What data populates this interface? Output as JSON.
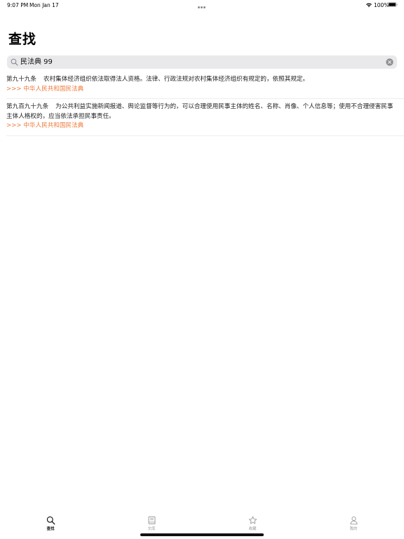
{
  "status_bar": {
    "time": "9:07 PM",
    "date": "Mon Jan 17",
    "battery_text": "100%"
  },
  "page": {
    "title": "查找"
  },
  "search": {
    "value": "民法典 99",
    "placeholder": ""
  },
  "results": [
    {
      "article": "第九十九条",
      "text": "农村集体经济组织依法取得法人资格。法律、行政法规对农村集体经济组织有规定的，依照其规定。",
      "source": ">>> 中华人民共和国民法典"
    },
    {
      "article": "第九百九十九条",
      "text": "为公共利益实施新闻报道、舆论监督等行为的，可以合理使用民事主体的姓名、名称、肖像、个人信息等；使用不合理侵害民事主体人格权的，应当依法承担民事责任。",
      "source": ">>> 中华人民共和国民法典"
    }
  ],
  "tabs": [
    {
      "label": "查找",
      "icon": "search-icon",
      "active": true
    },
    {
      "label": "文库",
      "icon": "book-icon",
      "active": false
    },
    {
      "label": "收藏",
      "icon": "star-icon",
      "active": false
    },
    {
      "label": "我的",
      "icon": "person-icon",
      "active": false
    }
  ],
  "colors": {
    "accent": "#ef7b3c",
    "search_bg": "#e9e9eb",
    "tab_inactive": "#9a9a9a"
  }
}
